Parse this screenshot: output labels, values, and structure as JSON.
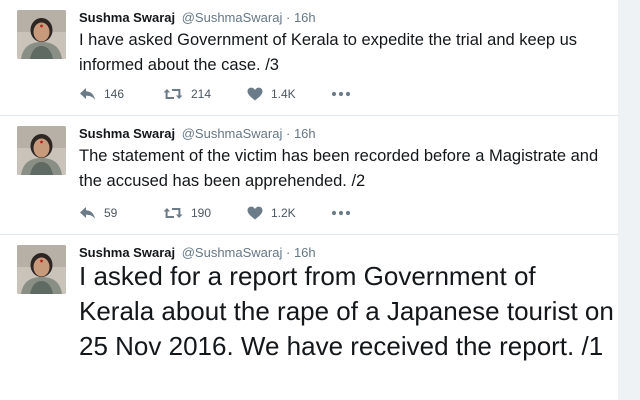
{
  "colors": {
    "text": "#14171a",
    "secondary": "#657786",
    "icon": "#6b7c88",
    "divider": "#e1e8ed"
  },
  "tweets": [
    {
      "name": "Sushma Swaraj",
      "handle": "@SushmaSwaraj",
      "separator": "·",
      "time": "16h",
      "text": "I have asked Government of Kerala to expedite the trial and keep us informed about the case. /3",
      "replies": "146",
      "retweets": "214",
      "likes": "1.4K",
      "icons": [
        "reply-icon",
        "retweet-icon",
        "heart-icon",
        "more-icon"
      ]
    },
    {
      "name": "Sushma Swaraj",
      "handle": "@SushmaSwaraj",
      "separator": "·",
      "time": "16h",
      "text": "The statement of the victim has been recorded before a Magistrate and the accused has been apprehended. /2",
      "replies": "59",
      "retweets": "190",
      "likes": "1.2K",
      "icons": [
        "reply-icon",
        "retweet-icon",
        "heart-icon",
        "more-icon"
      ]
    },
    {
      "name": "Sushma Swaraj",
      "handle": "@SushmaSwaraj",
      "separator": "·",
      "time": "16h",
      "text": "I asked for a report from Government of Kerala about the rape of a Japanese tourist on 25 Nov 2016. We have received the report. /1"
    }
  ]
}
